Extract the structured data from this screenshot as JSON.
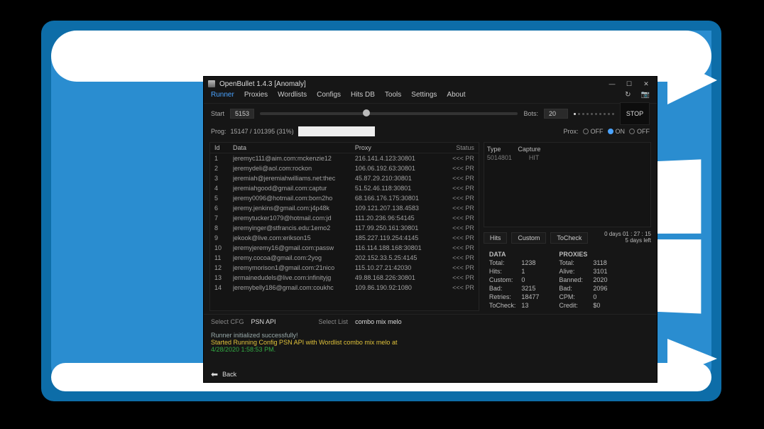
{
  "window": {
    "title": "OpenBullet 1.4.3 [Anomaly]",
    "min": "—",
    "max": "☐",
    "close": "✕",
    "menu": [
      "Runner",
      "Proxies",
      "Wordlists",
      "Configs",
      "Hits DB",
      "Tools",
      "Settings",
      "About"
    ],
    "icons": {
      "refresh": "↻",
      "camera": "📷"
    }
  },
  "toolbar": {
    "start_lbl": "Start",
    "start_val": "5153",
    "bots_lbl": "Bots:",
    "bots_val": "20",
    "stop": "STOP",
    "prog_lbl": "Prog:",
    "prog_val": "15147 / 101395 (31%)",
    "prox_lbl": "Prox:",
    "opt_off": "OFF",
    "opt_on": "ON",
    "opt_off2": "OFF"
  },
  "grid": {
    "hd": {
      "id": "Id",
      "data": "Data",
      "proxy": "Proxy",
      "status": "Status"
    },
    "rows": [
      {
        "id": "1",
        "data": "jeremyc111@aim.com:mckenzie12",
        "proxy": "216.141.4.123:30801",
        "st": "<<< PR"
      },
      {
        "id": "2",
        "data": "jeremydeli@aol.com:rockon",
        "proxy": "106.06.192.63:30801",
        "st": "<<< PR"
      },
      {
        "id": "3",
        "data": "jeremiah@jeremiahwilliams.net:thec",
        "proxy": "45.87.29.210:30801",
        "st": "<<< PR"
      },
      {
        "id": "4",
        "data": "jeremiahgood@gmail.com:captur",
        "proxy": "51.52.46.118:30801",
        "st": "<<< PR"
      },
      {
        "id": "5",
        "data": "jeremy0096@hotmail.com:born2ho",
        "proxy": "68.166.176.175:30801",
        "st": "<<< PR"
      },
      {
        "id": "6",
        "data": "jeremy.jenkins@gmail.com:j4p48k",
        "proxy": "109.121.207.138.4583",
        "st": "<<< PR"
      },
      {
        "id": "7",
        "data": "jeremytucker1079@hotmail.com:jd",
        "proxy": "111.20.236.96:54145",
        "st": "<<< PR"
      },
      {
        "id": "8",
        "data": "jeremyinger@stfrancis.edu:1emo2",
        "proxy": "117.99.250.161:30801",
        "st": "<<< PR"
      },
      {
        "id": "9",
        "data": "jekook@live.com:erikson15",
        "proxy": "185.227.119.254:4145",
        "st": "<<< PR"
      },
      {
        "id": "10",
        "data": "jeremyjeremy16@gmail.com:passw",
        "proxy": "116.114.188.168:30801",
        "st": "<<< PR"
      },
      {
        "id": "11",
        "data": "jeremy.cocoa@gmail.com:2yog",
        "proxy": "202.152.33.5.25:4145",
        "st": "<<< PR"
      },
      {
        "id": "12",
        "data": "jeremymorison1@gmail.com:21nico",
        "proxy": "115.10.27.21:42030",
        "st": "<<< PR"
      },
      {
        "id": "13",
        "data": "jermainedudels@live.com:infinityjg",
        "proxy": "49.88.168.226:30801",
        "st": "<<< PR"
      },
      {
        "id": "14",
        "data": "jeremybelly186@gmail.com:coukhc",
        "proxy": "109.86.190.92:1080",
        "st": "<<< PR"
      }
    ]
  },
  "capture": {
    "hd_type": "Type",
    "hd_cap": "Capture",
    "row_type": "5014801",
    "row_cap": "HIT"
  },
  "chips": {
    "hits": "Hits",
    "custom": "Custom",
    "tocheck": "ToCheck"
  },
  "uptime": {
    "line1": "0 days 01 : 27 : 15",
    "line2": "5 days left"
  },
  "stats": {
    "data_hd": "DATA",
    "prox_hd": "PROXIES",
    "total_l": "Total:",
    "total_v": "1238",
    "hits_l": "Hits:",
    "hits_v": "1",
    "custom_l": "Custom:",
    "custom_v": "0",
    "bad_l": "Bad:",
    "bad_v": "3215",
    "retries_l": "Retries:",
    "retries_v": "18477",
    "tocheck_l": "ToCheck:",
    "tocheck_v": "13",
    "p_total_l": "Total:",
    "p_total_v": "3118",
    "p_alive_l": "Alive:",
    "p_alive_v": "3101",
    "p_banned_l": "Banned:",
    "p_banned_v": "2020",
    "p_bad_l": "Bad:",
    "p_bad_v": "2096",
    "p_cpm_l": "CPM:",
    "p_cpm_v": "0",
    "p_credit_l": "Credit:",
    "p_credit_v": "$0"
  },
  "bottom": {
    "sel_cfg_l": "Select CFG",
    "sel_cfg_v": "PSN API",
    "sel_wl_l": "Select List",
    "sel_wl_v": "combo mix melo",
    "log": {
      "l1": "Runner initialized successfully!",
      "l2": "Started Running Config PSN API with Wordlist combo mix melo at",
      "l3": "4/28/2020 1:58:53 PM."
    },
    "back": "Back"
  }
}
